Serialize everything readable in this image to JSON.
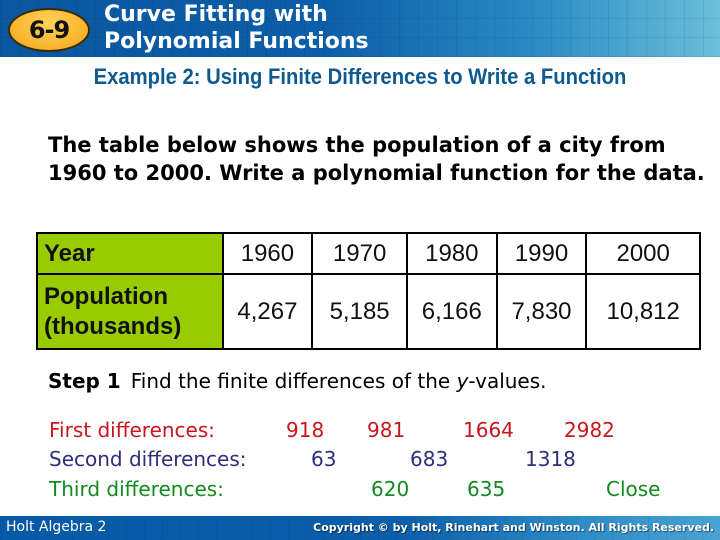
{
  "header": {
    "lesson_badge": "6-9",
    "title_line1": "Curve Fitting with",
    "title_line2": "Polynomial Functions",
    "badge_color": "#f7b22b",
    "bar_color": "#0d5ea8"
  },
  "example": {
    "title": "Example 2: Using Finite Differences to Write a Function",
    "title_color": "#0e5a8f"
  },
  "prompt": {
    "text": "The table below shows the population of a city from 1960 to 2000. Write a polynomial function for the data."
  },
  "table": {
    "header_color": "#99cc00",
    "rows": [
      {
        "label": "Year",
        "values": [
          "1960",
          "1970",
          "1980",
          "1990",
          "2000"
        ]
      },
      {
        "label_line1": "Population",
        "label_line2": "(thousands)",
        "values": [
          "4,267",
          "5,185",
          "6,166",
          "7,830",
          "10,812"
        ]
      }
    ]
  },
  "step": {
    "label": "Step 1",
    "text_before": "Find the finite differences of the ",
    "variable": "y",
    "text_after": "-values."
  },
  "differences": {
    "first": {
      "label": "First differences:",
      "values": [
        "918",
        "981",
        "1664",
        "2982"
      ],
      "color": "#c8161d"
    },
    "second": {
      "label": "Second differences:",
      "values": [
        "63",
        "683",
        "1318"
      ],
      "color": "#2d2f7a"
    },
    "third": {
      "label": "Third differences:",
      "values": [
        "620",
        "635"
      ],
      "note": "Close",
      "color": "#138a1e"
    }
  },
  "footer": {
    "left": "Holt Algebra 2",
    "right": "Copyright © by Holt, Rinehart and Winston. All Rights Reserved."
  }
}
